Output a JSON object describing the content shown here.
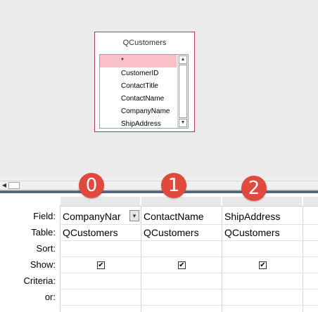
{
  "table_box": {
    "title": "QCustomers",
    "fields": [
      "*",
      "CustomerID",
      "ContactTitle",
      "ContactName",
      "CompanyName",
      "ShipAddress"
    ],
    "selected_index": 0,
    "scroll_up_icon": "triangle-up",
    "scroll_down_icon": "triangle-down"
  },
  "grid": {
    "row_labels": [
      "Field:",
      "Table:",
      "Sort:",
      "Show:",
      "Criteria:",
      "or:"
    ],
    "columns": [
      {
        "badge": "0",
        "field": "CompanyNar",
        "table": "QCustomers",
        "show": true
      },
      {
        "badge": "1",
        "field": "ContactName",
        "table": "QCustomers",
        "show": true
      },
      {
        "badge": "2",
        "field": "ShipAddress",
        "table": "QCustomers",
        "show": true
      }
    ],
    "dropdown_icon": "▾",
    "check_glyph": "✔"
  },
  "colors": {
    "badge": "#e04a3e",
    "selected_field": "#f9c0c8",
    "table_border": "#b0405a",
    "divider": "#5a6580"
  }
}
